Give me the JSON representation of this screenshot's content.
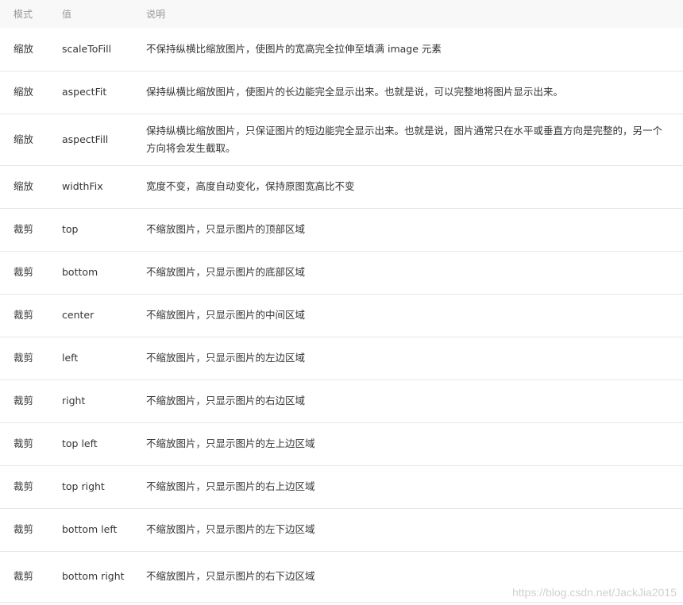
{
  "table": {
    "headers": [
      "模式",
      "值",
      "说明"
    ],
    "rows": [
      {
        "mode": "缩放",
        "value": "scaleToFill",
        "desc": "不保持纵横比缩放图片，使图片的宽高完全拉伸至填满 image 元素"
      },
      {
        "mode": "缩放",
        "value": "aspectFit",
        "desc": "保持纵横比缩放图片，使图片的长边能完全显示出来。也就是说，可以完整地将图片显示出来。"
      },
      {
        "mode": "缩放",
        "value": "aspectFill",
        "desc": "保持纵横比缩放图片，只保证图片的短边能完全显示出来。也就是说，图片通常只在水平或垂直方向是完整的，另一个方向将会发生截取。"
      },
      {
        "mode": "缩放",
        "value": "widthFix",
        "desc": "宽度不变，高度自动变化，保持原图宽高比不变"
      },
      {
        "mode": "裁剪",
        "value": "top",
        "desc": "不缩放图片，只显示图片的顶部区域"
      },
      {
        "mode": "裁剪",
        "value": "bottom",
        "desc": "不缩放图片，只显示图片的底部区域"
      },
      {
        "mode": "裁剪",
        "value": "center",
        "desc": "不缩放图片，只显示图片的中间区域"
      },
      {
        "mode": "裁剪",
        "value": "left",
        "desc": "不缩放图片，只显示图片的左边区域"
      },
      {
        "mode": "裁剪",
        "value": "right",
        "desc": "不缩放图片，只显示图片的右边区域"
      },
      {
        "mode": "裁剪",
        "value": "top left",
        "desc": "不缩放图片，只显示图片的左上边区域"
      },
      {
        "mode": "裁剪",
        "value": "top right",
        "desc": "不缩放图片，只显示图片的右上边区域"
      },
      {
        "mode": "裁剪",
        "value": "bottom left",
        "desc": "不缩放图片，只显示图片的左下边区域"
      },
      {
        "mode": "裁剪",
        "value": "bottom right",
        "desc": "不缩放图片，只显示图片的右下边区域"
      }
    ]
  },
  "watermark": "https://blog.csdn.net/JackJia2015"
}
